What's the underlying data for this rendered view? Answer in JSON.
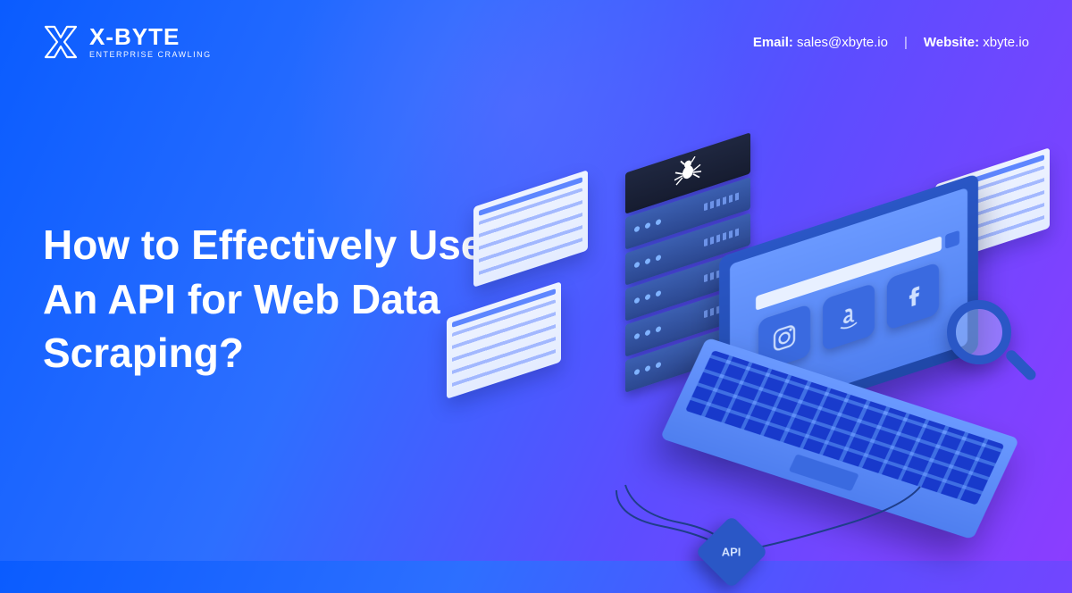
{
  "brand": {
    "name": "X-BYTE",
    "tagline": "ENTERPRISE CRAWLING"
  },
  "contact": {
    "email_label": "Email:",
    "email_value": "sales@xbyte.io",
    "separator": "|",
    "website_label": "Website:",
    "website_value": "xbyte.io"
  },
  "heading": "How to Effectively Use An API for Web Data Scraping?",
  "illustration": {
    "api_label": "API",
    "apps": [
      "instagram",
      "amazon",
      "facebook"
    ]
  }
}
